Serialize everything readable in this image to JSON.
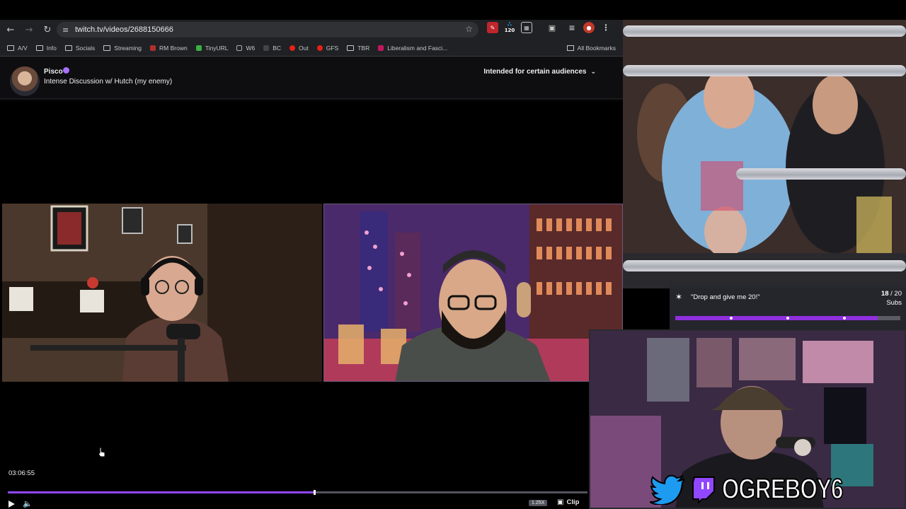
{
  "browser": {
    "url": "twitch.tv/videos/2688150666",
    "extension_badge": "120",
    "bookmarks": [
      {
        "label": "A/V",
        "type": "folder"
      },
      {
        "label": "Info",
        "type": "folder"
      },
      {
        "label": "Socials",
        "type": "folder"
      },
      {
        "label": "Streaming",
        "type": "folder"
      },
      {
        "label": "RM Brown",
        "type": "site"
      },
      {
        "label": "TinyURL",
        "type": "site"
      },
      {
        "label": "W6",
        "type": "site"
      },
      {
        "label": "BC",
        "type": "site"
      },
      {
        "label": "Out",
        "type": "site"
      },
      {
        "label": "GFS",
        "type": "site"
      },
      {
        "label": "TBR",
        "type": "folder"
      },
      {
        "label": "Liberalism and Fasci...",
        "type": "site"
      }
    ],
    "all_bookmarks": "All Bookmarks"
  },
  "channel": {
    "name": "Pisco",
    "title": "Intense Discussion w/ Hutch (my enemy)",
    "audience": "Intended for certain audiences"
  },
  "player": {
    "timecode": "03:06:55",
    "progress_fraction": 0.529,
    "speed": "1.25X",
    "clip_label": "Clip"
  },
  "goal": {
    "text": "\"Drop and give me 20!\"",
    "current": "18",
    "total": "/ 20",
    "unit": "Subs",
    "fraction": 0.9
  },
  "overlay": {
    "streamer_name": "OGREBOY6"
  },
  "colors": {
    "twitch_purple": "#9147ff",
    "goal_purple": "#8f2fdd",
    "twitter_blue": "#1d9bf0"
  }
}
